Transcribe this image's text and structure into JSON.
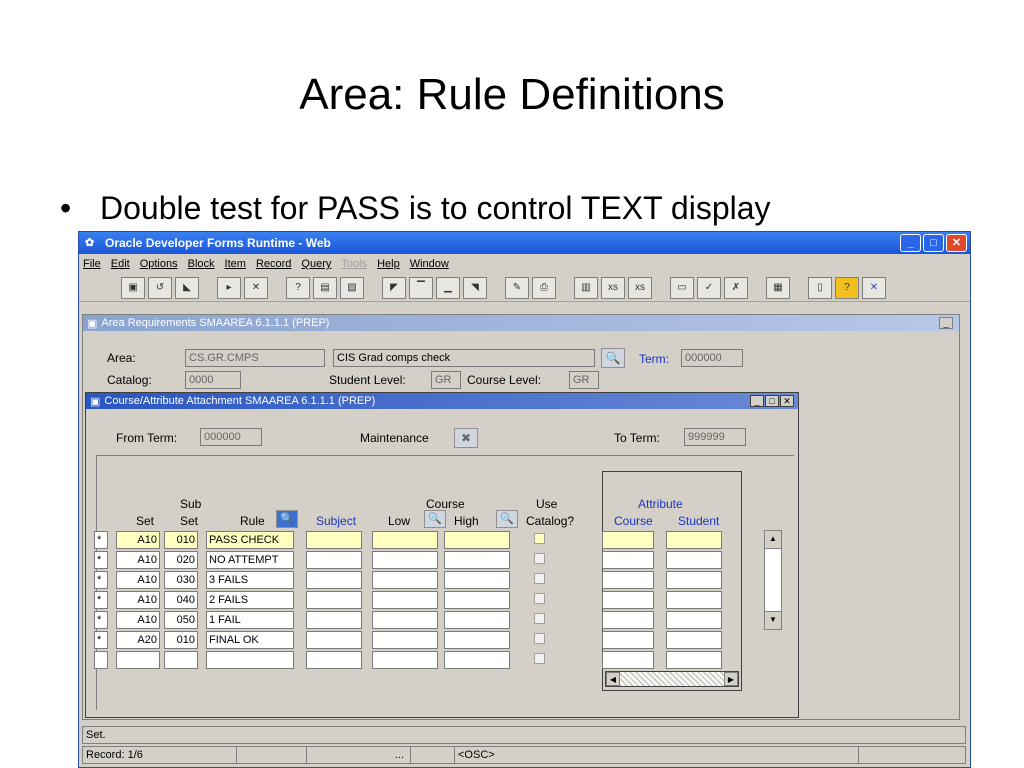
{
  "slide": {
    "title": "Area: Rule Definitions",
    "bullet": "Double test for PASS is to control TEXT display"
  },
  "window": {
    "title": "Oracle Developer Forms Runtime - Web",
    "menus": [
      "File",
      "Edit",
      "Options",
      "Block",
      "Item",
      "Record",
      "Query",
      "Tools",
      "Help",
      "Window"
    ],
    "disabled_menu": "Tools"
  },
  "area_form": {
    "header": "Area Requirements  SMAAREA  6.1.1.1  (PREP)",
    "area_label": "Area:",
    "area_value": "CS.GR.CMPS",
    "area_desc": "CIS Grad comps check",
    "term_label": "Term:",
    "term_value": "000000",
    "catalog_label": "Catalog:",
    "catalog_value": "0000",
    "student_level_label": "Student Level:",
    "student_level_value": "GR",
    "course_level_label": "Course Level:",
    "course_level_value": "GR"
  },
  "attach_form": {
    "header": "Course/Attribute Attachment  SMAAREA  6.1.1.1  (PREP)",
    "from_term_label": "From Term:",
    "from_term_value": "000000",
    "maintenance_label": "Maintenance",
    "to_term_label": "To Term:",
    "to_term_value": "999999",
    "headers": {
      "sub": "Sub",
      "set": "Set",
      "subset": "Set",
      "rule": "Rule",
      "subject": "Subject",
      "course": "Course",
      "low": "Low",
      "high": "High",
      "use": "Use",
      "catalog": "Catalog?",
      "attribute": "Attribute",
      "attr_course": "Course",
      "attr_student": "Student"
    },
    "rows": [
      {
        "mark": "*",
        "set": "A10",
        "subset": "010",
        "rule": "PASS CHECK"
      },
      {
        "mark": "*",
        "set": "A10",
        "subset": "020",
        "rule": "NO ATTEMPT"
      },
      {
        "mark": "*",
        "set": "A10",
        "subset": "030",
        "rule": "3 FAILS"
      },
      {
        "mark": "*",
        "set": "A10",
        "subset": "040",
        "rule": "2 FAILS"
      },
      {
        "mark": "*",
        "set": "A10",
        "subset": "050",
        "rule": "1 FAIL"
      },
      {
        "mark": "*",
        "set": "A20",
        "subset": "010",
        "rule": "FINAL OK"
      },
      {
        "mark": "",
        "set": "",
        "subset": "",
        "rule": ""
      }
    ]
  },
  "status": {
    "message": "Set.",
    "record": "Record: 1/6",
    "ellipsis": "...",
    "osc": "<OSC>"
  }
}
